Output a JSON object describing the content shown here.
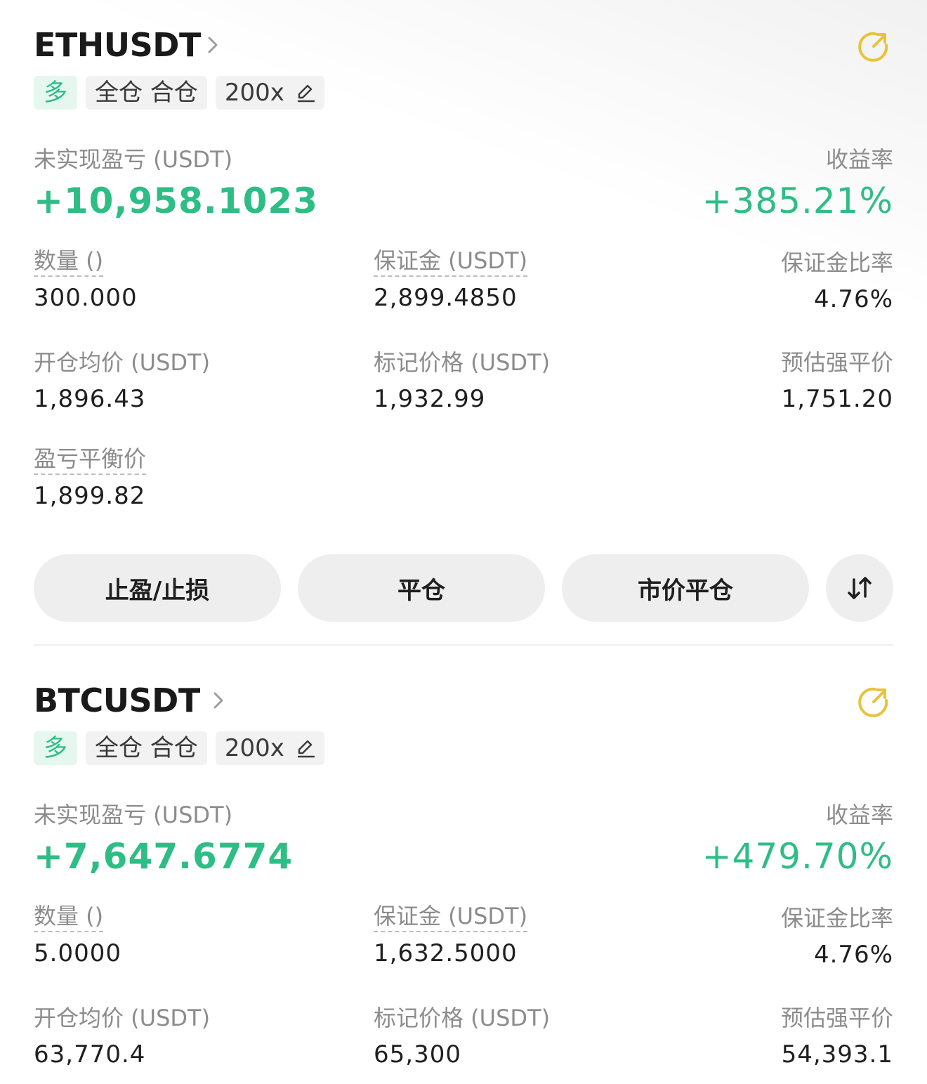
{
  "colors": {
    "profit": "#2ebd85",
    "share_icon": "#e8c33a",
    "label": "#8c8c8c"
  },
  "positions": [
    {
      "symbol": "ETHUSDT",
      "side": "多",
      "margin_mode": "全仓 合仓",
      "leverage": "200x",
      "unrealized_pnl_label": "未实现盈亏 (USDT)",
      "unrealized_pnl": "+10,958.1023",
      "roe_label": "收益率",
      "roe": "+385.21%",
      "quantity_label": "数量 ()",
      "quantity": "300.000",
      "margin_label": "保证金 (USDT)",
      "margin": "2,899.4850",
      "margin_ratio_label": "保证金比率",
      "margin_ratio": "4.76%",
      "entry_price_label": "开仓均价 (USDT)",
      "entry_price": "1,896.43",
      "mark_price_label": "标记价格 (USDT)",
      "mark_price": "1,932.99",
      "liq_price_label": "预估强平价",
      "liq_price": "1,751.20",
      "breakeven_label": "盈亏平衡价",
      "breakeven": "1,899.82",
      "buttons": {
        "tpsl": "止盈/止损",
        "close": "平仓",
        "market_close": "市价平仓",
        "reverse_icon": "swap-arrows-icon"
      }
    },
    {
      "symbol": "BTCUSDT",
      "side": "多",
      "margin_mode": "全仓 合仓",
      "leverage": "200x",
      "unrealized_pnl_label": "未实现盈亏 (USDT)",
      "unrealized_pnl": "+7,647.6774",
      "roe_label": "收益率",
      "roe": "+479.70%",
      "quantity_label": "数量 ()",
      "quantity": "5.0000",
      "margin_label": "保证金 (USDT)",
      "margin": "1,632.5000",
      "margin_ratio_label": "保证金比率",
      "margin_ratio": "4.76%",
      "entry_price_label": "开仓均价 (USDT)",
      "entry_price": "63,770.4",
      "mark_price_label": "标记价格 (USDT)",
      "mark_price": "65,300",
      "liq_price_label": "预估强平价",
      "liq_price": "54,393.1"
    }
  ]
}
